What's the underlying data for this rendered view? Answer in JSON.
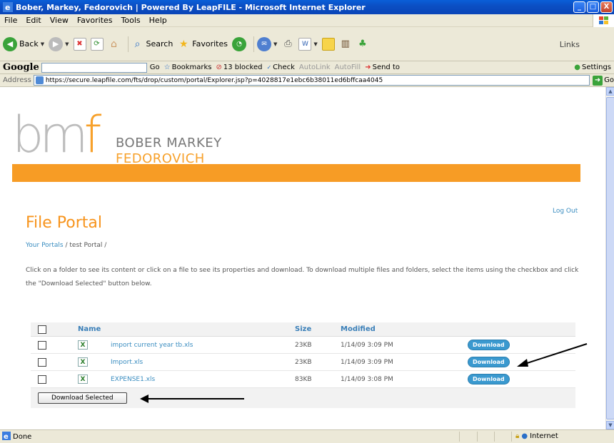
{
  "window": {
    "title": "Bober, Markey, Fedorovich | Powered By LeapFILE - Microsoft Internet Explorer",
    "controls": {
      "minimize": "_",
      "maximize": "□",
      "close": "X"
    }
  },
  "menu": {
    "items": [
      "File",
      "Edit",
      "View",
      "Favorites",
      "Tools",
      "Help"
    ],
    "underlines": [
      "F",
      "E",
      "V",
      "a",
      "T",
      "H"
    ]
  },
  "toolbar": {
    "back": "Back",
    "search": "Search",
    "favorites": "Favorites",
    "links": "Links"
  },
  "google_bar": {
    "logo": "Google",
    "go": "Go",
    "bookmarks": "Bookmarks",
    "blocked": "13 blocked",
    "check": "Check",
    "autolink": "AutoLink",
    "autofill": "AutoFill",
    "send_to": "Send to",
    "settings": "Settings"
  },
  "address_bar": {
    "label": "Address",
    "url": "https://secure.leapfile.com/fts/drop/custom/portal/Explorer.jsp?p=4028817e1ebc6b38011ed6bffcaa4045",
    "go": "Go"
  },
  "page": {
    "logo": {
      "letters": "bm",
      "f": "f",
      "line1": "BOBER MARKEY",
      "line2": "FEDOROVICH"
    },
    "logout": "Log Out",
    "title": "File Portal",
    "breadcrumb": {
      "link": "Your Portals",
      "sep": " / ",
      "current": "test Portal /"
    },
    "instructions": "Click on a folder to see its content or click on a file to see its properties and download. To download multiple files and folders, select the items using the checkbox and click the \"Download Selected\" button below.",
    "table": {
      "headers": {
        "name": "Name",
        "size": "Size",
        "modified": "Modified"
      },
      "rows": [
        {
          "name": "import current year tb.xls",
          "size": "23KB",
          "modified": "1/14/09 3:09 PM",
          "action": "Download"
        },
        {
          "name": "Import.xls",
          "size": "23KB",
          "modified": "1/14/09 3:09 PM",
          "action": "Download"
        },
        {
          "name": "EXPENSE1.xls",
          "size": "83KB",
          "modified": "1/14/09 3:08 PM",
          "action": "Download"
        }
      ],
      "download_selected": "Download Selected"
    }
  },
  "status": {
    "left": "Done",
    "zone": "Internet"
  },
  "colors": {
    "accent_orange": "#f79c25",
    "link_blue": "#3a8dc0",
    "title_bar": "#0b4fc4"
  }
}
